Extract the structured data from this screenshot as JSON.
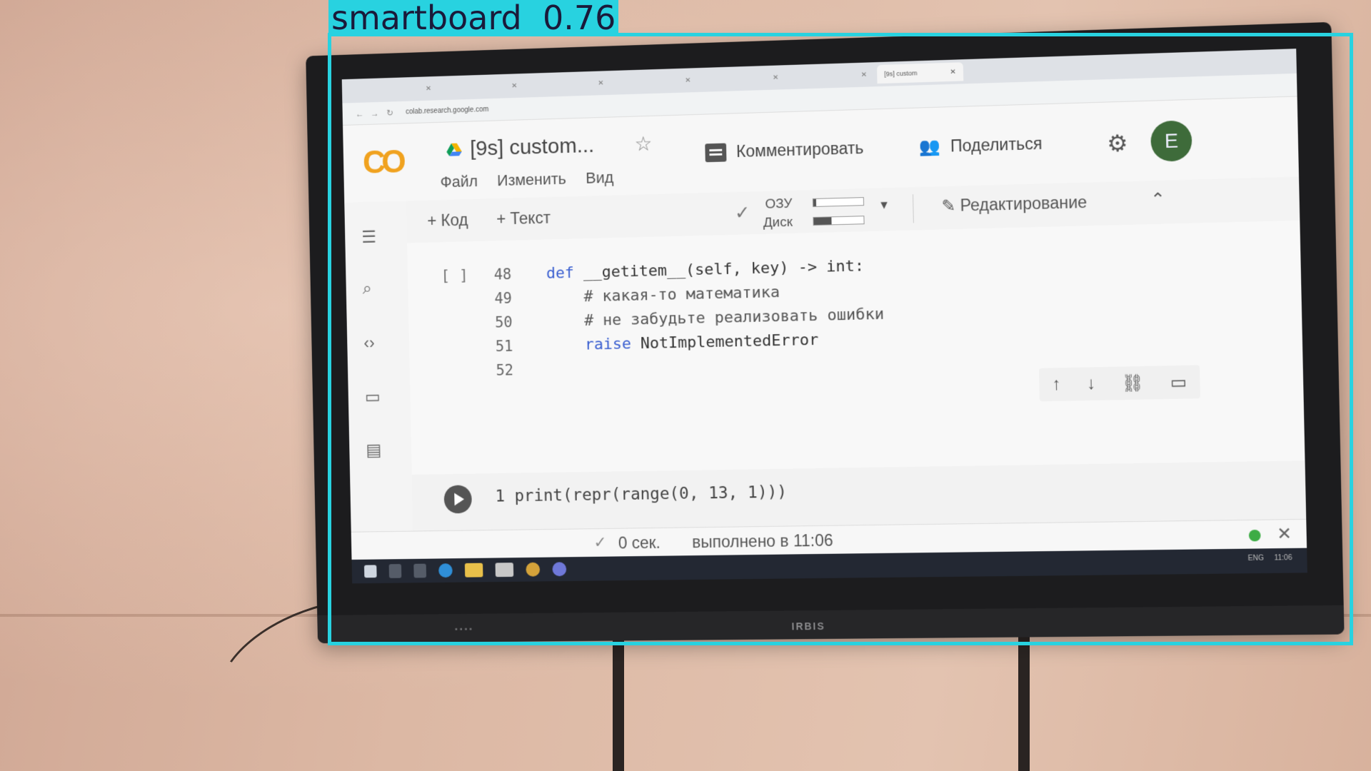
{
  "detection": {
    "label": "smartboard",
    "score": "0.76",
    "color": "#28d2e0"
  },
  "browser": {
    "url": "colab.research.google.com",
    "active_tab": "[9s] custom"
  },
  "colab": {
    "logo": "CO",
    "doc_title": "[9s] custom...",
    "menu": [
      "Файл",
      "Изменить",
      "Вид"
    ],
    "comment_label": "Комментировать",
    "share_label": "Поделиться",
    "avatar_letter": "E",
    "toolbar": {
      "add_code": "+ Код",
      "add_text": "+ Текст",
      "ram_label": "ОЗУ",
      "disk_label": "Диск",
      "edit_label": "Редактирование"
    },
    "ram_usage": 0.05,
    "disk_usage": 0.35,
    "code_lines": [
      {
        "num": "48",
        "kw": "def",
        "text": " __getitem__(self, key) -> int:"
      },
      {
        "num": "49",
        "text": "    # какая-то математика"
      },
      {
        "num": "50",
        "text": "    # не забудьте реализовать ошибки"
      },
      {
        "num": "51",
        "kw": "raise",
        "text": " NotImplementedError"
      },
      {
        "num": "52",
        "text": ""
      }
    ],
    "cell_bracket": "[ ]",
    "run_cell": {
      "num": "1",
      "code": "print(repr(range(0, 13, 1)))"
    },
    "status": {
      "time": "0 сек.",
      "done": "выполнено в 11:06"
    }
  },
  "taskbar": {
    "lang": "ENG",
    "clock": "11:06"
  },
  "tv": {
    "brand": "IRBIS"
  }
}
